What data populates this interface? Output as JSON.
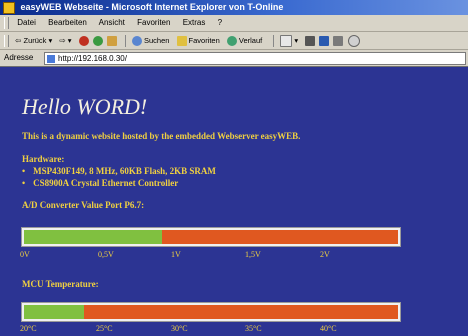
{
  "window": {
    "title": "easyWEB Webseite - Microsoft Internet Explorer von T-Online"
  },
  "menubar": {
    "items": [
      "Datei",
      "Bearbeiten",
      "Ansicht",
      "Favoriten",
      "Extras",
      "?"
    ]
  },
  "toolbar": {
    "back": "Zurück",
    "search": "Suchen",
    "favorites": "Favoriten",
    "history": "Verlauf"
  },
  "addressbar": {
    "label": "Adresse",
    "url": "http://192.168.0.30/"
  },
  "page": {
    "heading": "Hello WORD!",
    "intro": "This is a dynamic website hosted by the embedded Webserver easyWEB.",
    "hardware_heading": "Hardware:",
    "hardware_items": [
      "MSP430F149, 8 MHz, 60KB Flash, 2KB SRAM",
      "CS8900A Crystal Ethernet Controller"
    ],
    "ad_heading": "A/D Converter Value Port P6.7:",
    "ad_gauge": {
      "fraction": 0.37
    },
    "ad_scale": [
      "0V",
      "0,5V",
      "1V",
      "1,5V",
      "2V"
    ],
    "mcu_heading": "MCU Temperature:",
    "mcu_gauge": {
      "fraction": 0.16
    },
    "mcu_scale": [
      "20°C",
      "25°C",
      "30°C",
      "35°C",
      "40°C"
    ]
  },
  "colors": {
    "page_bg": "#2c3493",
    "text_yellow": "#f0d040",
    "gauge_green": "#80c040",
    "gauge_orange": "#e05820"
  }
}
